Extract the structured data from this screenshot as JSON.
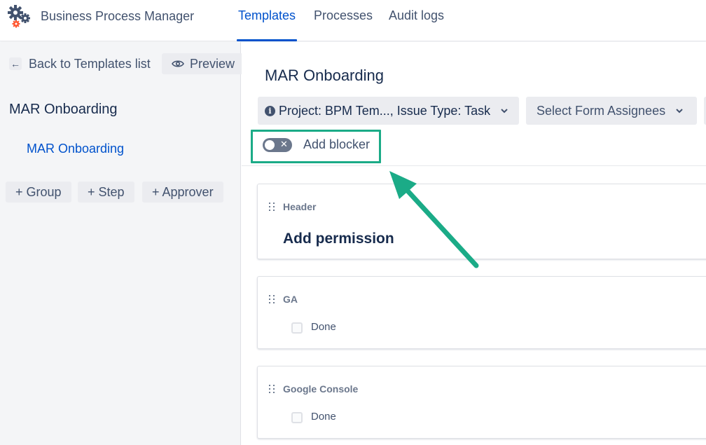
{
  "app": {
    "title": "Business Process Manager"
  },
  "nav": {
    "tabs": [
      {
        "label": "Templates",
        "active": true
      },
      {
        "label": "Processes"
      },
      {
        "label": "Audit logs"
      }
    ]
  },
  "sidebar": {
    "back_label": "Back to Templates list",
    "preview_label": "Preview",
    "template_title": "MAR Onboarding",
    "steps": [
      {
        "label": "MAR Onboarding"
      }
    ],
    "add_buttons": {
      "group": "+ Group",
      "step": "+ Step",
      "approver": "+ Approver"
    }
  },
  "main": {
    "title": "MAR Onboarding",
    "project_select": "Project: BPM Tem..., Issue Type: Task",
    "assignees_select": "Select Form Assignees",
    "blocker_toggle": {
      "label": "Add blocker",
      "on": false
    },
    "cards": [
      {
        "label": "Header",
        "heading": "Add permission"
      },
      {
        "label": "GA",
        "checkbox": "Done"
      },
      {
        "label": "Google Console",
        "checkbox": "Done"
      }
    ]
  },
  "colors": {
    "accent": "#0052cc",
    "highlight": "#1bab87",
    "sidebar_bg": "#f4f5f7"
  }
}
